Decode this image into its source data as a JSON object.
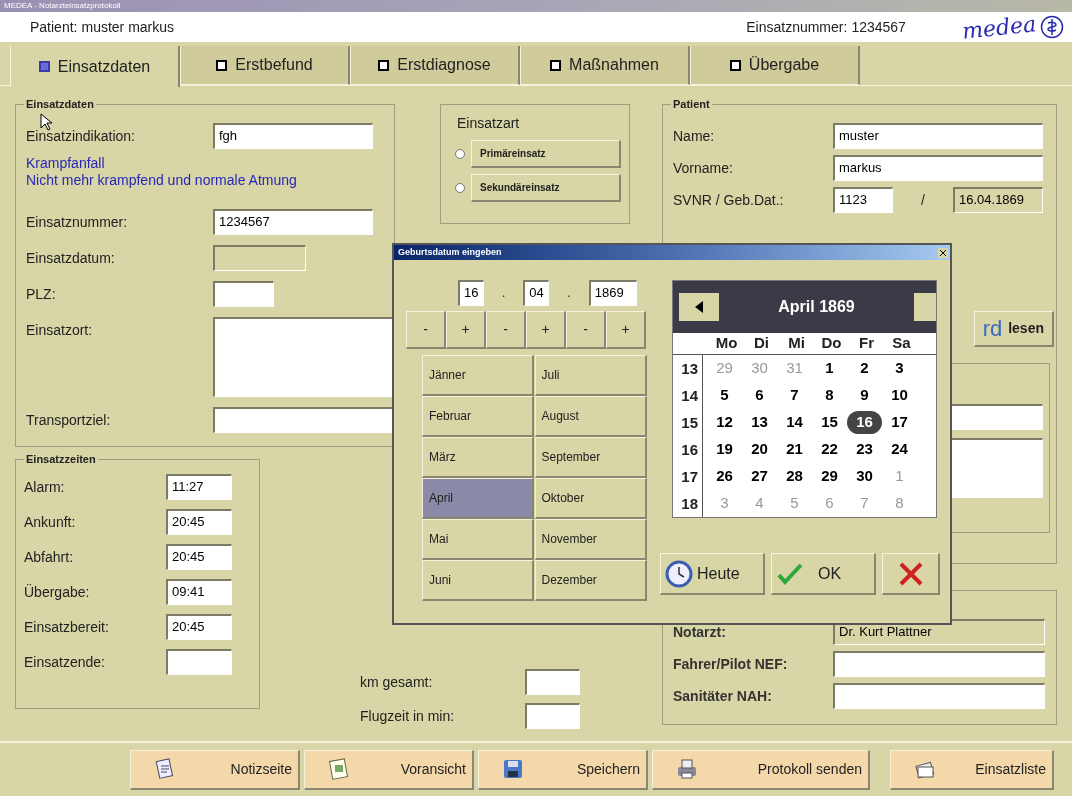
{
  "window": {
    "title": "MEDEA - Notarzteinsatzprotokoll"
  },
  "header": {
    "patient_label": "Patient:",
    "patient_name": "muster markus",
    "case_label": "Einsatznummer:",
    "case_number": "1234567",
    "logo": "medea"
  },
  "tabs": [
    {
      "label": "Einsatzdaten",
      "selected": true
    },
    {
      "label": "Erstbefund",
      "selected": false
    },
    {
      "label": "Erstdiagnose",
      "selected": false
    },
    {
      "label": "Maßnahmen",
      "selected": false
    },
    {
      "label": "Übergabe",
      "selected": false
    }
  ],
  "einsatzdaten": {
    "title": "Einsatzdaten",
    "fields": [
      {
        "label": "Einsatzindikation:",
        "value": "fgh",
        "kind": "text"
      },
      {
        "kind": "note",
        "lines": [
          "Krampfanfall",
          "Nicht mehr krampfend und normale Atmung"
        ]
      },
      {
        "label": "Einsatznummer:",
        "value": "1234567",
        "kind": "text"
      },
      {
        "label": "Einsatzdatum:",
        "kind": "date",
        "disabled": true
      },
      {
        "label": "PLZ:",
        "kind": "zip"
      },
      {
        "label": "Einsatzort:",
        "kind": "multiline"
      },
      {
        "label": "Transportziel:",
        "kind": "text"
      }
    ]
  },
  "einsatzart": {
    "title": "Einsatzart",
    "options": [
      {
        "label": "Primäreinsatz",
        "selected": false
      },
      {
        "label": "Sekundäreinsatz",
        "selected": false
      }
    ]
  },
  "patient": {
    "title": "Patient",
    "name_label": "Name:",
    "name": "muster",
    "first_label": "Vorname:",
    "first": "markus",
    "svnr_label": "SVNR / Geb.Dat.:",
    "svnr": "1123",
    "slash": "/",
    "birthdate": "16.04.1869",
    "card_button": {
      "logo": "rd",
      "label": "lesen"
    }
  },
  "einsatzzeiten": {
    "title": "Einsatzzeiten",
    "rows": [
      {
        "label": "Alarm:",
        "value": "11:27"
      },
      {
        "label": "Ankunft:",
        "value": "20:45"
      },
      {
        "label": "Abfahrt:",
        "value": "20:45"
      },
      {
        "label": "Übergabe:",
        "value": "09:41"
      },
      {
        "label": "Einsatzbereit:",
        "value": "20:45"
      },
      {
        "label": "Einsatzende:"
      }
    ]
  },
  "trip": {
    "rows": [
      {
        "label": "km gesamt:"
      },
      {
        "label": "Flugzeit in min:"
      }
    ]
  },
  "crew": {
    "rows": [
      {
        "label": "Notarzt:",
        "value": "Dr. Kurt Plattner",
        "disabled": true
      },
      {
        "label": "Fahrer/Pilot NEF:"
      },
      {
        "label": "Sanitäter NAH:"
      }
    ]
  },
  "dialog": {
    "title": "Geburtsdatum eingeben",
    "day": "16",
    "month": "04",
    "year": "1869",
    "separators": [
      ".",
      "."
    ],
    "steppers": [
      "-",
      "+",
      "-",
      "+",
      "-",
      "+"
    ],
    "months": [
      {
        "label": "Jänner",
        "selected": false
      },
      {
        "label": "Februar",
        "selected": false
      },
      {
        "label": "März",
        "selected": false
      },
      {
        "label": "April",
        "selected": true
      },
      {
        "label": "Mai",
        "selected": false
      },
      {
        "label": "Juni",
        "selected": false
      },
      {
        "label": "Juli",
        "selected": false
      },
      {
        "label": "August",
        "selected": false
      },
      {
        "label": "September",
        "selected": false
      },
      {
        "label": "Oktober",
        "selected": false
      },
      {
        "label": "November",
        "selected": false
      },
      {
        "label": "Dezember",
        "selected": false
      }
    ],
    "calendar": {
      "title": "April 1869",
      "weekdays": [
        "Mo",
        "Di",
        "Mi",
        "Do",
        "Fr",
        "Sa"
      ],
      "weeks": [
        {
          "number": "13",
          "days": [
            {
              "label": "29",
              "muted": true,
              "selected": false
            },
            {
              "label": "30",
              "muted": true,
              "selected": false
            },
            {
              "label": "31",
              "muted": true,
              "selected": false
            },
            {
              "label": "1",
              "muted": false,
              "selected": false
            },
            {
              "label": "2",
              "muted": false,
              "selected": false
            },
            {
              "label": "3",
              "muted": false,
              "selected": false
            }
          ]
        },
        {
          "number": "14",
          "days": [
            {
              "label": "5",
              "muted": false,
              "selected": false
            },
            {
              "label": "6",
              "muted": false,
              "selected": false
            },
            {
              "label": "7",
              "muted": false,
              "selected": false
            },
            {
              "label": "8",
              "muted": false,
              "selected": false
            },
            {
              "label": "9",
              "muted": false,
              "selected": false
            },
            {
              "label": "10",
              "muted": false,
              "selected": false
            }
          ]
        },
        {
          "number": "15",
          "days": [
            {
              "label": "12",
              "muted": false,
              "selected": false
            },
            {
              "label": "13",
              "muted": false,
              "selected": false
            },
            {
              "label": "14",
              "muted": false,
              "selected": false
            },
            {
              "label": "15",
              "muted": false,
              "selected": false
            },
            {
              "label": "16",
              "muted": false,
              "selected": true
            },
            {
              "label": "17",
              "muted": false,
              "selected": false
            }
          ]
        },
        {
          "number": "16",
          "days": [
            {
              "label": "19",
              "muted": false,
              "selected": false
            },
            {
              "label": "20",
              "muted": false,
              "selected": false
            },
            {
              "label": "21",
              "muted": false,
              "selected": false
            },
            {
              "label": "22",
              "muted": false,
              "selected": false
            },
            {
              "label": "23",
              "muted": false,
              "selected": false
            },
            {
              "label": "24",
              "muted": false,
              "selected": false
            }
          ]
        },
        {
          "number": "17",
          "days": [
            {
              "label": "26",
              "muted": false,
              "selected": false
            },
            {
              "label": "27",
              "muted": false,
              "selected": false
            },
            {
              "label": "28",
              "muted": false,
              "selected": false
            },
            {
              "label": "29",
              "muted": false,
              "selected": false
            },
            {
              "label": "30",
              "muted": false,
              "selected": false
            },
            {
              "label": "1",
              "muted": true,
              "selected": false
            }
          ]
        },
        {
          "number": "18",
          "days": [
            {
              "label": "3",
              "muted": true,
              "selected": false
            },
            {
              "label": "4",
              "muted": true,
              "selected": false
            },
            {
              "label": "5",
              "muted": true,
              "selected": false
            },
            {
              "label": "6",
              "muted": true,
              "selected": false
            },
            {
              "label": "7",
              "muted": true,
              "selected": false
            },
            {
              "label": "8",
              "muted": true,
              "selected": false
            }
          ]
        }
      ]
    },
    "buttons": [
      {
        "kind": "today",
        "label": "Heute"
      },
      {
        "kind": "ok",
        "label": "OK"
      },
      {
        "kind": "cancel"
      }
    ]
  },
  "footer": {
    "buttons": [
      {
        "kind": "notes",
        "label": "Notizseite"
      },
      {
        "kind": "preview",
        "label": "Voransicht"
      },
      {
        "kind": "save",
        "label": "Speichern"
      },
      {
        "kind": "send",
        "label": "Protokoll senden"
      },
      {
        "kind": "list",
        "label": "Einsatzliste"
      }
    ]
  }
}
